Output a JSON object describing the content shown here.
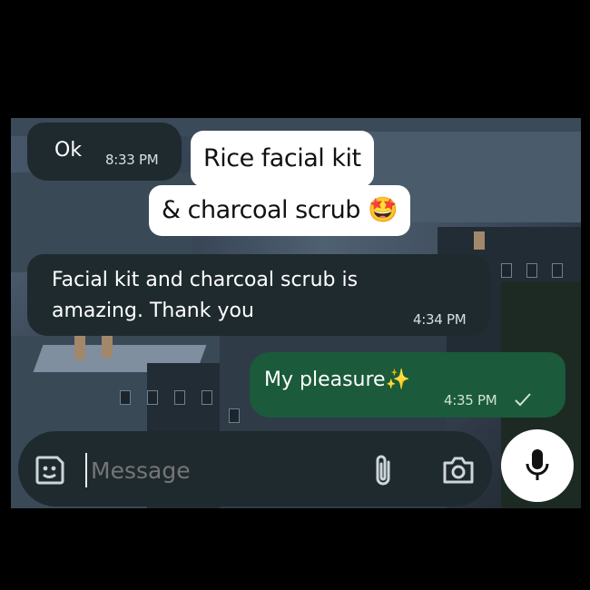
{
  "messages": [
    {
      "text": "Ok",
      "time": "8:33 PM",
      "direction": "incoming"
    },
    {
      "text": "Facial kit and charcoal scrub is amazing. Thank you",
      "line1": "Facial kit and charcoal scrub is",
      "line2": "amazing. Thank you",
      "time": "4:34 PM",
      "direction": "incoming"
    },
    {
      "text": "My pleasure✨",
      "time": "4:35 PM",
      "direction": "outgoing",
      "status": "sent-check"
    }
  ],
  "overlay_caption": {
    "line1": "Rice facial kit",
    "line2": "& charcoal scrub 🤩"
  },
  "composer": {
    "placeholder": "Message",
    "emoji_icon": "sticker-icon",
    "attach_icon": "paperclip-icon",
    "camera_icon": "camera-icon",
    "mic_icon": "mic-icon"
  },
  "colors": {
    "incoming_bubble": "#1f2a2f",
    "outgoing_bubble": "#1b5a3b",
    "mic_button": "#ffffff"
  }
}
